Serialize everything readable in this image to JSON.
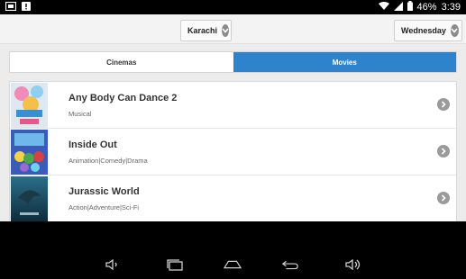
{
  "status_bar": {
    "battery": "46%",
    "time": "3:39"
  },
  "filters": {
    "city": "Karachi",
    "day": "Wednesday"
  },
  "tabs": [
    {
      "label": "Cinemas",
      "active": false
    },
    {
      "label": "Movies",
      "active": true
    }
  ],
  "movies": [
    {
      "title": "Any Body Can Dance 2",
      "genre": "Musical"
    },
    {
      "title": "Inside Out",
      "genre": "Animation|Comedy|Drama"
    },
    {
      "title": "Jurassic World",
      "genre": "Action|Adventure|Sci-Fi"
    }
  ],
  "colors": {
    "accent": "#2f83cc"
  }
}
